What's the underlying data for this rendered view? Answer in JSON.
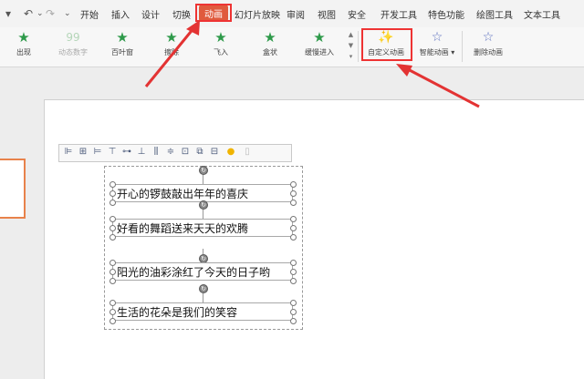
{
  "quick_access": {
    "undo": "↶",
    "redo": "↷",
    "dropdown": "⌄"
  },
  "menu": {
    "tabs": [
      "开始",
      "插入",
      "设计",
      "切换",
      "动画",
      "幻灯片放映",
      "审阅",
      "视图",
      "安全",
      "开发工具",
      "特色功能",
      "绘图工具",
      "文本工具"
    ],
    "active": "动画"
  },
  "ribbon": {
    "animations": [
      "出现",
      "动态数字",
      "百叶窗",
      "擦除",
      "飞入",
      "盒状",
      "缓慢进入"
    ],
    "custom_animation": "自定义动画",
    "smart_animation": "智能动画",
    "delete_animation": "删除动画"
  },
  "slide": {
    "text_boxes": [
      "开心的锣鼓敲出年年的喜庆",
      "好看的舞蹈送来天天的欢腾",
      "阳光的油彩涂红了今天的日子哟",
      "生活的花朵是我们的笑容"
    ]
  },
  "annotation_color": "#e33333",
  "accent_color": "#e05a3d"
}
